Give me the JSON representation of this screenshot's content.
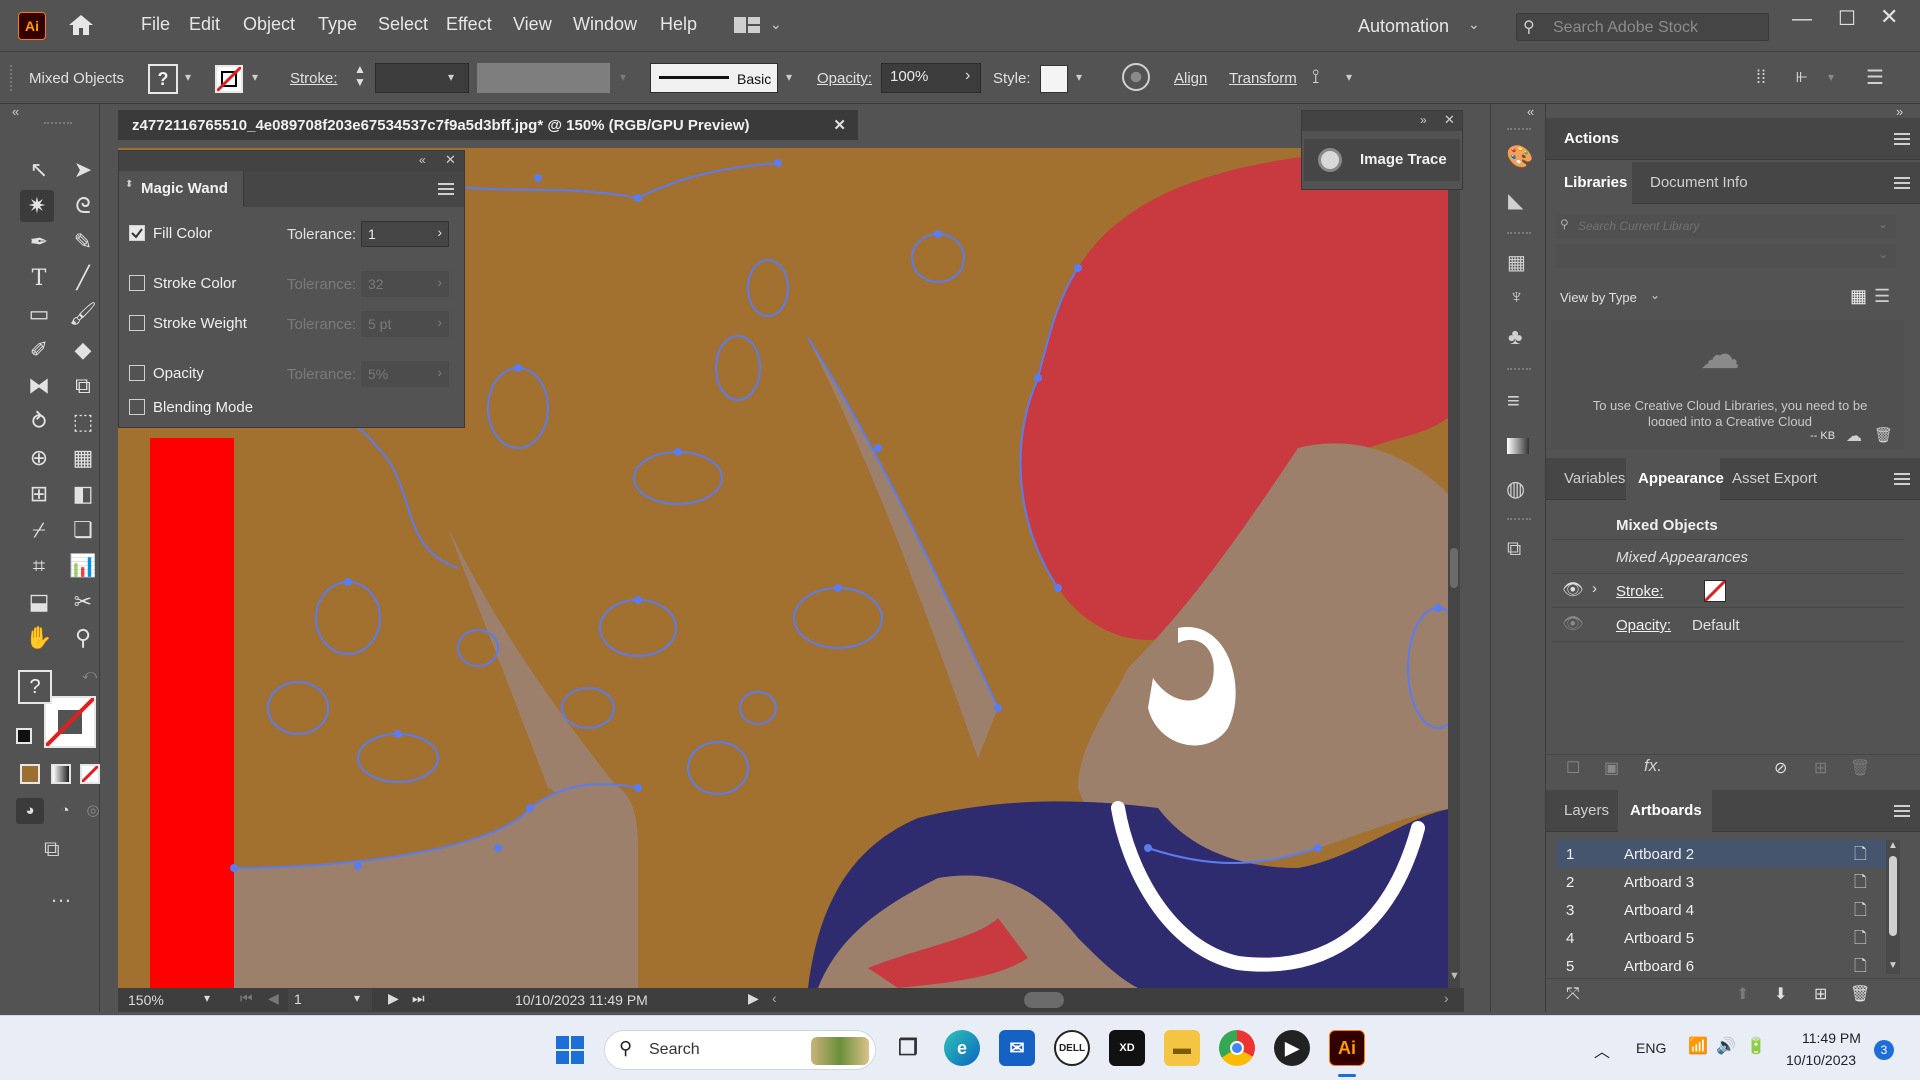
{
  "app": {
    "logo": "Ai",
    "window_title": "z4772116765510_4e089708f203e67534537c7f9a5d3bff.jpg* @ 150% (RGB/GPU Preview)"
  },
  "menubar": {
    "items": [
      "File",
      "Edit",
      "Object",
      "Type",
      "Select",
      "Effect",
      "View",
      "Window",
      "Help"
    ],
    "workspace": "Automation",
    "search_placeholder": "Search Adobe Stock"
  },
  "controlbar": {
    "selection": "Mixed Objects",
    "fill_symbol": "?",
    "stroke_label": "Stroke:",
    "brush_label": "Basic",
    "opacity_label": "Opacity:",
    "opacity_value": "100%",
    "style_label": "Style:",
    "align_label": "Align",
    "transform_label": "Transform"
  },
  "magic_wand": {
    "title": "Magic Wand",
    "rows": [
      {
        "label": "Fill Color",
        "checked": true,
        "tolerance_label": "Tolerance:",
        "tolerance": "1",
        "enabled": true
      },
      {
        "label": "Stroke Color",
        "checked": false,
        "tolerance_label": "Tolerance:",
        "tolerance": "32",
        "enabled": false
      },
      {
        "label": "Stroke Weight",
        "checked": false,
        "tolerance_label": "Tolerance:",
        "tolerance": "5 pt",
        "enabled": false
      },
      {
        "label": "Opacity",
        "checked": false,
        "tolerance_label": "Tolerance:",
        "tolerance": "5%",
        "enabled": false
      },
      {
        "label": "Blending Mode",
        "checked": false
      }
    ]
  },
  "image_trace": {
    "label": "Image Trace"
  },
  "tools": {
    "fill_symbol": "?"
  },
  "status": {
    "zoom": "150%",
    "artboard": "1",
    "datetime": "10/10/2023  11:49 PM"
  },
  "panels": {
    "actions_tab": "Actions",
    "libraries_tab": "Libraries",
    "docinfo_tab": "Document Info",
    "search_library_placeholder": "Search Current Library",
    "view_by": "View by Type",
    "cc_message": "To use Creative Cloud Libraries, you need to be logged into a Creative Cloud",
    "kb": "-- KB",
    "variables_tab": "Variables",
    "appearance_tab": "Appearance",
    "asset_export_tab": "Asset Export",
    "appearance": {
      "title": "Mixed Objects",
      "subtitle": "Mixed Appearances",
      "stroke_label": "Stroke:",
      "opacity_label": "Opacity:",
      "opacity_value": "Default"
    },
    "layers_tab": "Layers",
    "artboards_tab": "Artboards",
    "artboards": [
      {
        "num": "1",
        "name": "Artboard 2"
      },
      {
        "num": "2",
        "name": "Artboard 3"
      },
      {
        "num": "3",
        "name": "Artboard 4"
      },
      {
        "num": "4",
        "name": "Artboard 5"
      },
      {
        "num": "5",
        "name": "Artboard 6"
      }
    ]
  },
  "taskbar": {
    "search": "Search",
    "lang": "ENG",
    "time": "11:49 PM",
    "date": "10/10/2023",
    "notification_count": "3"
  },
  "colors": {
    "canvas_brown": "#a2712f",
    "skin": "#9d806b",
    "red": "#c83a3f",
    "navy": "#2e2c6e",
    "selection_blue": "#5b7cf0",
    "guide_red": "#ff0000"
  }
}
